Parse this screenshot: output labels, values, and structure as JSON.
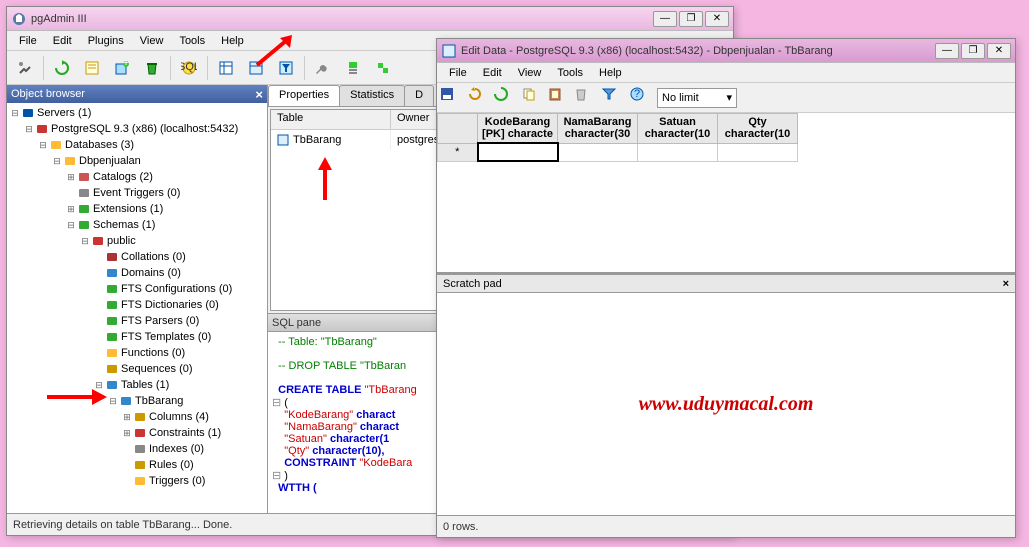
{
  "mainWindow": {
    "title": "pgAdmin III",
    "menu": [
      "File",
      "Edit",
      "Plugins",
      "View",
      "Tools",
      "Help"
    ],
    "toolbarIcons": [
      "plug",
      "refresh",
      "properties",
      "new-obj",
      "drop",
      "sql-editor",
      "sql-query",
      "view-data",
      "filter-data",
      "maintain",
      "execute",
      "guru"
    ],
    "objectBrowser": {
      "title": "Object browser",
      "tree": [
        {
          "depth": 0,
          "exp": "-",
          "icon": "servers",
          "label": "Servers (1)"
        },
        {
          "depth": 1,
          "exp": "-",
          "icon": "server",
          "label": "PostgreSQL 9.3 (x86) (localhost:5432)"
        },
        {
          "depth": 2,
          "exp": "-",
          "icon": "dbgroup",
          "label": "Databases (3)"
        },
        {
          "depth": 3,
          "exp": "-",
          "icon": "db",
          "label": "Dbpenjualan"
        },
        {
          "depth": 4,
          "exp": "+",
          "icon": "catalog",
          "label": "Catalogs (2)"
        },
        {
          "depth": 4,
          "exp": "",
          "icon": "event",
          "label": "Event Triggers (0)"
        },
        {
          "depth": 4,
          "exp": "+",
          "icon": "ext",
          "label": "Extensions (1)"
        },
        {
          "depth": 4,
          "exp": "-",
          "icon": "schema",
          "label": "Schemas (1)"
        },
        {
          "depth": 5,
          "exp": "-",
          "icon": "public",
          "label": "public"
        },
        {
          "depth": 6,
          "exp": "",
          "icon": "coll",
          "label": "Collations (0)"
        },
        {
          "depth": 6,
          "exp": "",
          "icon": "domain",
          "label": "Domains (0)"
        },
        {
          "depth": 6,
          "exp": "",
          "icon": "fts",
          "label": "FTS Configurations (0)"
        },
        {
          "depth": 6,
          "exp": "",
          "icon": "fts",
          "label": "FTS Dictionaries (0)"
        },
        {
          "depth": 6,
          "exp": "",
          "icon": "fts",
          "label": "FTS Parsers (0)"
        },
        {
          "depth": 6,
          "exp": "",
          "icon": "fts",
          "label": "FTS Templates (0)"
        },
        {
          "depth": 6,
          "exp": "",
          "icon": "func",
          "label": "Functions (0)"
        },
        {
          "depth": 6,
          "exp": "",
          "icon": "seq",
          "label": "Sequences (0)"
        },
        {
          "depth": 6,
          "exp": "-",
          "icon": "tables",
          "label": "Tables (1)"
        },
        {
          "depth": 7,
          "exp": "-",
          "icon": "table",
          "label": "TbBarang"
        },
        {
          "depth": 8,
          "exp": "+",
          "icon": "cols",
          "label": "Columns (4)"
        },
        {
          "depth": 8,
          "exp": "+",
          "icon": "cons",
          "label": "Constraints (1)"
        },
        {
          "depth": 8,
          "exp": "",
          "icon": "idx",
          "label": "Indexes (0)"
        },
        {
          "depth": 8,
          "exp": "",
          "icon": "rule",
          "label": "Rules (0)"
        },
        {
          "depth": 8,
          "exp": "",
          "icon": "trig",
          "label": "Triggers (0)"
        }
      ]
    },
    "tabs": [
      "Properties",
      "Statistics",
      "D"
    ],
    "grid": {
      "headers": [
        "Table",
        "Owner"
      ],
      "rows": [
        {
          "table": "TbBarang",
          "owner": "postgres"
        }
      ]
    },
    "sqlPane": {
      "title": "SQL pane",
      "lines": [
        {
          "t": "-- Table: \"TbBarang\"",
          "c": "kw-green"
        },
        {
          "t": "",
          "c": ""
        },
        {
          "t": "-- DROP TABLE \"TbBaran",
          "c": "kw-green"
        },
        {
          "t": "",
          "c": ""
        },
        {
          "t": "CREATE TABLE ",
          "c": "kw-blue",
          "a": "\"TbBarang",
          "ac": "kw-red"
        },
        {
          "t": "(",
          "c": "kw-black"
        },
        {
          "t": "  \"KodeBarang\"",
          "c": "kw-red",
          "a": " charact",
          "ac": "kw-blue"
        },
        {
          "t": "  \"NamaBarang\"",
          "c": "kw-red",
          "a": " charact",
          "ac": "kw-blue"
        },
        {
          "t": "  \"Satuan\"",
          "c": "kw-red",
          "a": " character(1",
          "ac": "kw-blue"
        },
        {
          "t": "  \"Qty\"",
          "c": "kw-red",
          "a": " character(10),",
          "ac": "kw-blue"
        },
        {
          "t": "  CONSTRAINT ",
          "c": "kw-blue",
          "a": "\"KodeBara",
          "ac": "kw-red"
        },
        {
          "t": ")",
          "c": "kw-black"
        },
        {
          "t": "WTTH (",
          "c": "kw-blue"
        }
      ]
    },
    "statusbar": "Retrieving details on table TbBarang... Done."
  },
  "editWindow": {
    "title": "Edit Data - PostgreSQL 9.3 (x86) (localhost:5432) - Dbpenjualan - TbBarang",
    "menu": [
      "File",
      "Edit",
      "View",
      "Tools",
      "Help"
    ],
    "toolbarIcons": [
      "save",
      "refresh",
      "undo",
      "copy",
      "paste",
      "delete",
      "filter",
      "help"
    ],
    "limitLabel": "No limit",
    "columns": [
      {
        "name": "KodeBarang",
        "type": "[PK] characte"
      },
      {
        "name": "NamaBarang",
        "type": "character(30"
      },
      {
        "name": "Satuan",
        "type": "character(10"
      },
      {
        "name": "Qty",
        "type": "character(10"
      }
    ],
    "scratchPad": "Scratch pad",
    "watermark": "www.uduymacal.com",
    "statusbar": "0 rows."
  }
}
